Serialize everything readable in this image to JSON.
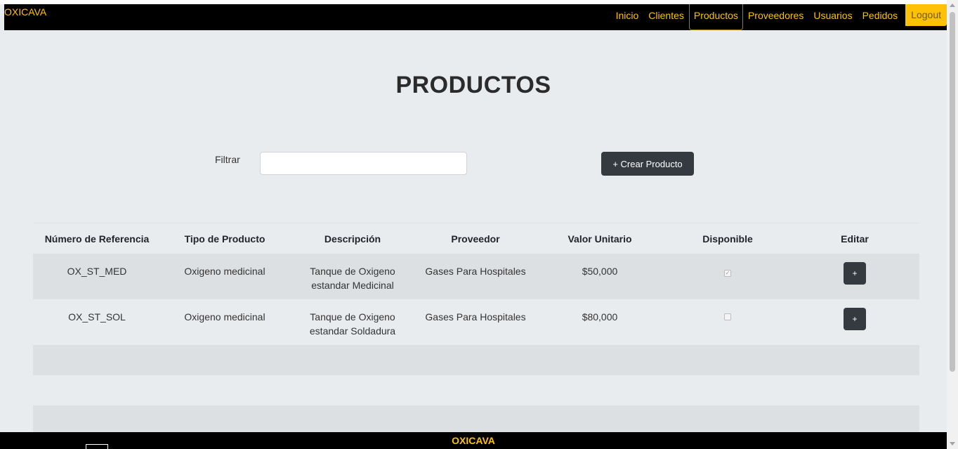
{
  "navbar": {
    "brand": "OXICAVA",
    "items": [
      {
        "label": "Inicio"
      },
      {
        "label": "Clientes"
      },
      {
        "label": "Productos"
      },
      {
        "label": "Proveedores"
      },
      {
        "label": "Usuarios"
      },
      {
        "label": "Pedidos"
      }
    ],
    "active_item": "Productos",
    "logout_label": "Logout"
  },
  "page": {
    "title": "PRODUCTOS"
  },
  "filter": {
    "label": "Filtrar",
    "value": "",
    "placeholder": ""
  },
  "create_button": {
    "label": "+ Crear Producto"
  },
  "table": {
    "headers": [
      "Número de Referencia",
      "Tipo de Producto",
      "Descripción",
      "Proveedor",
      "Valor Unitario",
      "Disponible",
      "Editar"
    ],
    "rows": [
      {
        "referencia": "OX_ST_MED",
        "tipo": "Oxigeno medicinal",
        "descripcion_line1": "Tanque de Oxigeno",
        "descripcion_line2": "estandar Medicinal",
        "proveedor": "Gases Para Hospitales",
        "valor": "$50,000",
        "disponible": true,
        "edit_label": "+"
      },
      {
        "referencia": "OX_ST_SOL",
        "tipo": "Oxigeno medicinal",
        "descripcion_line1": "Tanque de Oxigeno",
        "descripcion_line2": "estandar Soldadura",
        "proveedor": "Gases Para Hospitales",
        "valor": "$80,000",
        "disponible": false,
        "edit_label": "+"
      }
    ]
  },
  "footer": {
    "text": "OXICAVA"
  },
  "colors": {
    "accent": "#ffc107",
    "navbar_bg": "#000000",
    "page_bg": "#e9ecef",
    "button_dark": "#343a40"
  }
}
